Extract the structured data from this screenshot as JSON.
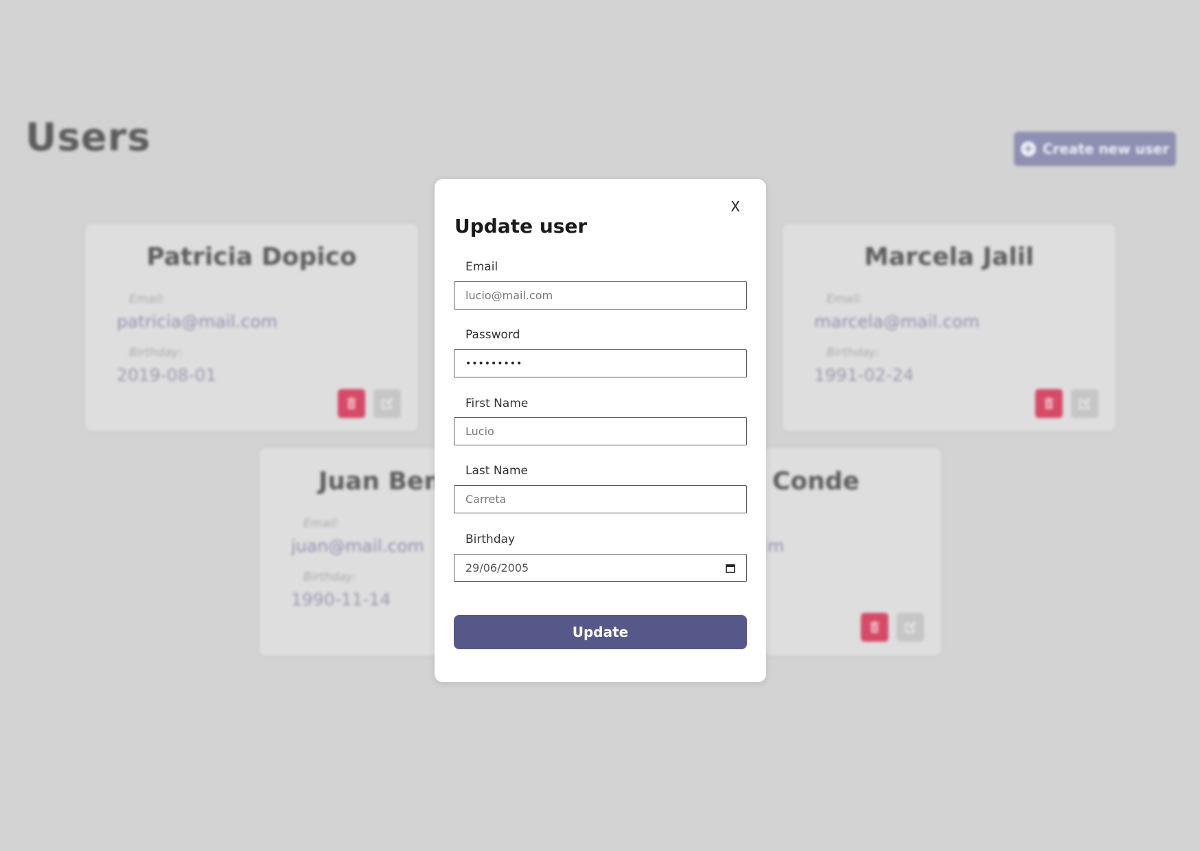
{
  "page": {
    "title": "Users",
    "create_button_label": "Create new user"
  },
  "colors": {
    "background": "#d3d3d3",
    "accent": "#555888",
    "delete": "#d64a68",
    "edit": "#c6c6c6",
    "email_text": "#8f91b3"
  },
  "users": [
    {
      "name": "Patricia Dopico",
      "email_label": "Email:",
      "email": "patricia@mail.com",
      "birthday_label": "Birthday:",
      "birthday": "2019-08-01"
    },
    {
      "name": "Marcela Jalil",
      "email_label": "Email:",
      "email": "marcela@mail.com",
      "birthday_label": "Birthday:",
      "birthday": "1991-02-24"
    },
    {
      "name": "Juan Ben",
      "email_label": "Email:",
      "email": "juan@mail.com",
      "birthday_label": "Birthday:",
      "birthday": "1990-11-14"
    },
    {
      "name": "Conde",
      "email_tail": "m"
    }
  ],
  "modal": {
    "close_label": "X",
    "title": "Update user",
    "fields": {
      "email": {
        "label": "Email",
        "value": "lucio@mail.com"
      },
      "password": {
        "label": "Password",
        "value": "•••••••••"
      },
      "first_name": {
        "label": "First Name",
        "value": "Lucio"
      },
      "last_name": {
        "label": "Last Name",
        "value": "Carreta"
      },
      "birthday": {
        "label": "Birthday",
        "value": "29/06/2005"
      }
    },
    "submit_label": "Update"
  },
  "icons": {
    "create": "plus-circle-icon",
    "delete": "trash-icon",
    "edit": "edit-icon",
    "date": "calendar-icon"
  }
}
